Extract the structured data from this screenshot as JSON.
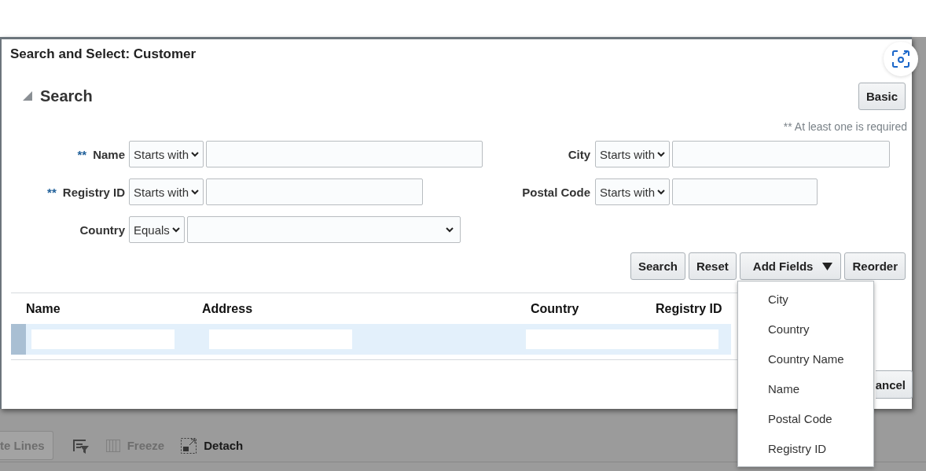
{
  "background_toolbar": {
    "lines_button": "te Lines",
    "freeze": {
      "label": "Freeze",
      "disabled": true
    },
    "detach": {
      "label": "Detach",
      "disabled": false
    }
  },
  "dialog": {
    "title": "Search and Select: Customer",
    "section": {
      "title": "Search",
      "expanded": true
    },
    "mode_button": "Basic",
    "required_note": "** At least one is required",
    "criteria": [
      {
        "label": "Name",
        "required_mark": "**",
        "operator": "Starts with",
        "kind": "text"
      },
      {
        "label": "City",
        "operator": "Starts with",
        "kind": "text"
      },
      {
        "label": "Registry ID",
        "required_mark": "**",
        "operator": "Starts with",
        "kind": "text"
      },
      {
        "label": "Postal Code",
        "operator": "Starts with",
        "kind": "text"
      },
      {
        "label": "Country",
        "operator": "Equals",
        "kind": "select"
      }
    ],
    "buttons": [
      {
        "label": "Search",
        "kind": "plain"
      },
      {
        "label": "Reset",
        "kind": "plain"
      },
      {
        "label": "Add Fields",
        "kind": "menu",
        "expanded": true
      },
      {
        "label": "Reorder",
        "kind": "plain"
      }
    ],
    "table": {
      "columns": [
        "Name",
        "Address",
        "Country",
        "Registry ID"
      ],
      "rows": [
        {
          "selected": true
        }
      ]
    },
    "cancel_button": "ancel"
  },
  "add_fields_menu": {
    "items": [
      "City",
      "Country",
      "Country Name",
      "Name",
      "Postal Code",
      "Registry ID"
    ]
  }
}
